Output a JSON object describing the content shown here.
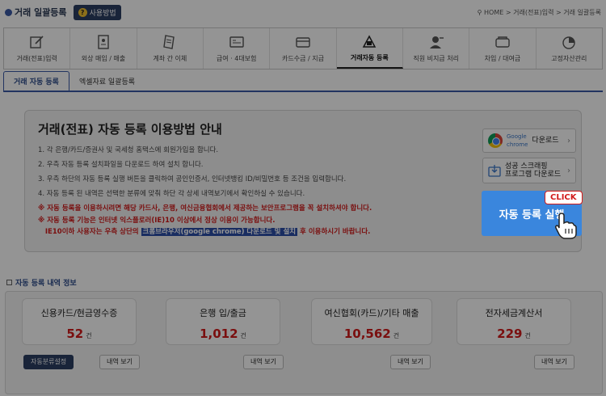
{
  "header": {
    "title": "거래 일괄등록",
    "help_label": "사용방법",
    "breadcrumb": "⚲ HOME > 거래(전표)입력 > 거래 일괄등록"
  },
  "menu": [
    {
      "label": "거래(전표)입력",
      "icon": "edit-icon"
    },
    {
      "label": "외상 매입 / 매출",
      "icon": "ledger-icon"
    },
    {
      "label": "계좌 간 이체",
      "icon": "document-icon"
    },
    {
      "label": "급여 · 4대보험",
      "icon": "id-card-icon"
    },
    {
      "label": "카드수금 / 지급",
      "icon": "card-icon"
    },
    {
      "label": "거래자동 등록",
      "icon": "robot-icon",
      "active": true
    },
    {
      "label": "직원 비지급 처리",
      "icon": "user-icon"
    },
    {
      "label": "차입 / 대여금",
      "icon": "wallet-icon"
    },
    {
      "label": "고정자산관리",
      "icon": "chart-icon"
    }
  ],
  "subtabs": [
    "거래 자동 등록",
    "엑셀자료 일괄등록"
  ],
  "guide": {
    "title": "거래(전표) 자동 등록 이용방법 안내",
    "items": [
      "1. 각 은행/카드/증권사 및 국세청 홈택스에 회원가입을 합니다.",
      "2. 우측 자동 등록 설치파일을 다운로드 하여 설치 합니다.",
      "3. 우측 하단의 자동 등록 실행 버튼을 클릭하여 공인인증서, 인터넷뱅킹 ID/비밀번호 등 조건을 입력합니다.",
      "4. 자동 등록 된 내역은 선택한 분류에 맞춰 하단 각 상세 내역보기에서 확인하실 수 있습니다.",
      "※ 자동 등록을 이용하시려면 해당 카드사, 은행, 여신금융협회에서 제공하는 보안프로그램을 꼭 설치하셔야 합니다."
    ],
    "notice_line1": "※ 자동 등록 기능은 인터넷 익스플로러(IE)10 이상에서 정상 이용이 가능합니다.",
    "notice_line2_pre": "IE10이하 사용자는 우측 상단의 ",
    "notice_line2_hl": "크롬브라우저(google chrome) 다운로드 및 설치",
    "notice_line2_post": " 후 이용하시기 바랍니다."
  },
  "download": {
    "chrome_brand_top": "Google",
    "chrome_brand_bottom": "chrome",
    "chrome_label": "다운로드",
    "scraping_line1": "성공 스크래핑",
    "scraping_line2": "프로그램 다운로드"
  },
  "run": {
    "label": "자동 등록 실행",
    "badge": "CLICK"
  },
  "summary": {
    "title": "자동 등록 내역 정보",
    "cards": [
      {
        "name": "신용카드/현금영수증",
        "value": "52",
        "unit": "건"
      },
      {
        "name": "은행 입/출금",
        "value": "1,012",
        "unit": "건"
      },
      {
        "name": "여신협회(카드)/기타 매출",
        "value": "10,562",
        "unit": "건"
      },
      {
        "name": "전자세금계산서",
        "value": "229",
        "unit": "건"
      }
    ],
    "auto_classify_label": "자동분류설정",
    "view_label": "내역 보기"
  },
  "colors": {
    "accent": "#3a86dd",
    "navy": "#2c3e63",
    "red": "#d21a1a"
  }
}
